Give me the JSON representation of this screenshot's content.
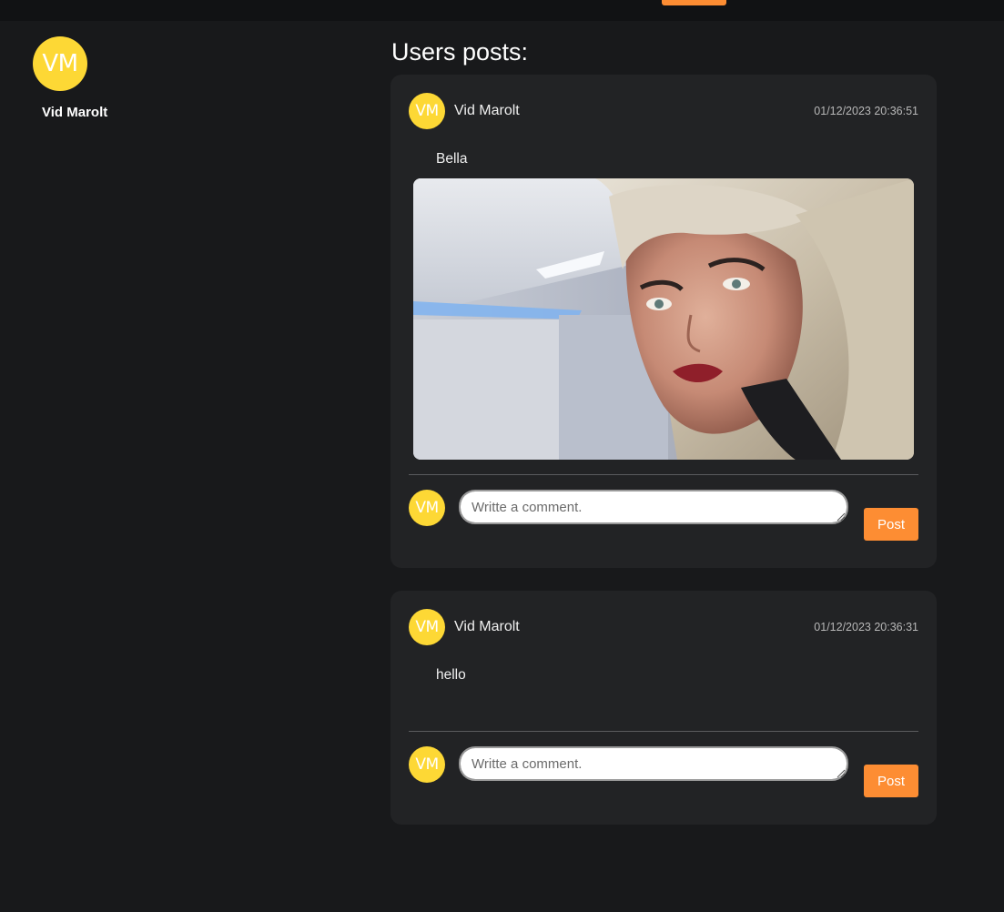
{
  "profile": {
    "initials": "VM",
    "name": "Vid Marolt"
  },
  "main": {
    "title": "Users posts:"
  },
  "posts": [
    {
      "author_initials": "VM",
      "author": "Vid Marolt",
      "timestamp": "01/12/2023 20:36:51",
      "text": "Bella",
      "has_image": true,
      "comment_avatar_initials": "VM",
      "comment_placeholder": "Writte a comment.",
      "post_button_label": "Post"
    },
    {
      "author_initials": "VM",
      "author": "Vid Marolt",
      "timestamp": "01/12/2023 20:36:31",
      "text": "hello",
      "has_image": false,
      "comment_avatar_initials": "VM",
      "comment_placeholder": "Writte a comment.",
      "post_button_label": "Post"
    }
  ],
  "colors": {
    "accent": "#fd8d33",
    "avatar": "#fdd835",
    "background": "#18191b",
    "card": "#222325"
  }
}
